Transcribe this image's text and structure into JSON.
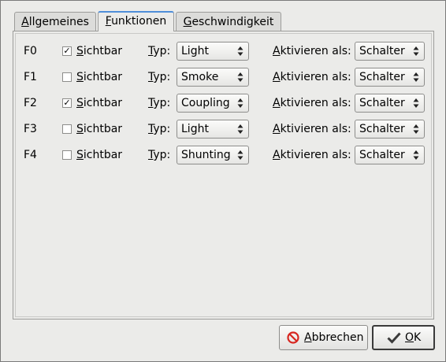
{
  "tabs": [
    {
      "label": "Allgemeines",
      "mnemonic": "A",
      "rest": "llgemeines"
    },
    {
      "label": "Funktionen",
      "mnemonic": "F",
      "rest": "unktionen",
      "active": true
    },
    {
      "label": "Geschwindigkeit",
      "mnemonic": "G",
      "rest": "eschwindigkeit"
    }
  ],
  "labels": {
    "visible_first": "S",
    "visible_rest": "ichtbar",
    "type_first": "T",
    "type_rest": "yp:",
    "activate_first": "A",
    "activate_rest": "ktivieren als:"
  },
  "functions": [
    {
      "id": "F0",
      "visible": true,
      "type": "Light",
      "activate": "Schalter"
    },
    {
      "id": "F1",
      "visible": false,
      "type": "Smoke",
      "activate": "Schalter"
    },
    {
      "id": "F2",
      "visible": true,
      "type": "Coupling",
      "activate": "Schalter"
    },
    {
      "id": "F3",
      "visible": false,
      "type": "Light",
      "activate": "Schalter"
    },
    {
      "id": "F4",
      "visible": false,
      "type": "Shunting",
      "activate": "Schalter"
    }
  ],
  "buttons": {
    "cancel": {
      "first": "A",
      "rest": "bbrechen",
      "icon": "cancel-icon",
      "icon_color": "#d7261f"
    },
    "ok": {
      "first": "O",
      "rest": "K",
      "icon": "checkmark-icon",
      "icon_color": "#3a3a3a"
    }
  },
  "check_glyph": "✓"
}
